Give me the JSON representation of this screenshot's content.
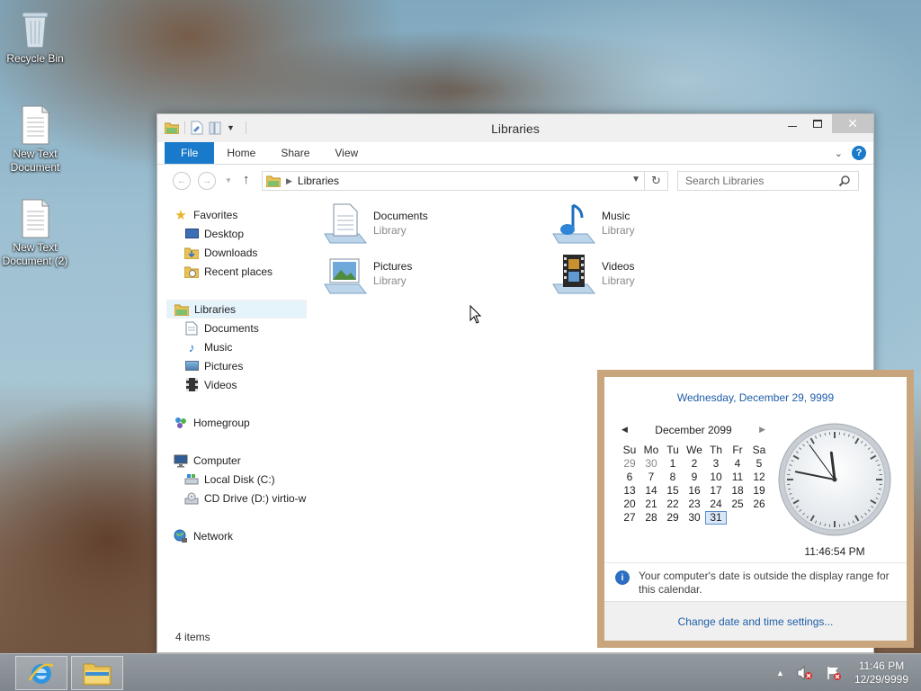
{
  "desktop": {
    "icons": [
      {
        "label": "Recycle Bin"
      },
      {
        "label": "New Text Document"
      },
      {
        "label": "New Text Document (2)"
      }
    ]
  },
  "window": {
    "title": "Libraries",
    "ribbon_tabs": [
      "File",
      "Home",
      "Share",
      "View"
    ],
    "address": {
      "crumb": "Libraries"
    },
    "search_placeholder": "Search Libraries",
    "status": "4 items"
  },
  "navpane": {
    "favorites": {
      "label": "Favorites",
      "items": [
        "Desktop",
        "Downloads",
        "Recent places"
      ]
    },
    "libraries": {
      "label": "Libraries",
      "items": [
        "Documents",
        "Music",
        "Pictures",
        "Videos"
      ]
    },
    "homegroup": "Homegroup",
    "computer": {
      "label": "Computer",
      "items": [
        "Local Disk (C:)",
        "CD Drive (D:) virtio-w"
      ]
    },
    "network": "Network"
  },
  "content": {
    "items": [
      {
        "name": "Documents",
        "type": "Library",
        "icon": "documents-library-icon"
      },
      {
        "name": "Music",
        "type": "Library",
        "icon": "music-library-icon"
      },
      {
        "name": "Pictures",
        "type": "Library",
        "icon": "pictures-library-icon"
      },
      {
        "name": "Videos",
        "type": "Library",
        "icon": "videos-library-icon"
      }
    ]
  },
  "flyout": {
    "long_date": "Wednesday, December 29, 9999",
    "calendar": {
      "month_label": "December 2099",
      "weekdays": [
        "Su",
        "Mo",
        "Tu",
        "We",
        "Th",
        "Fr",
        "Sa"
      ],
      "days": [
        {
          "d": "29",
          "dim": true
        },
        {
          "d": "30",
          "dim": true
        },
        {
          "d": "1"
        },
        {
          "d": "2"
        },
        {
          "d": "3"
        },
        {
          "d": "4"
        },
        {
          "d": "5"
        },
        {
          "d": "6"
        },
        {
          "d": "7"
        },
        {
          "d": "8"
        },
        {
          "d": "9"
        },
        {
          "d": "10"
        },
        {
          "d": "11"
        },
        {
          "d": "12"
        },
        {
          "d": "13"
        },
        {
          "d": "14"
        },
        {
          "d": "15"
        },
        {
          "d": "16"
        },
        {
          "d": "17"
        },
        {
          "d": "18"
        },
        {
          "d": "19"
        },
        {
          "d": "20"
        },
        {
          "d": "21"
        },
        {
          "d": "22"
        },
        {
          "d": "23"
        },
        {
          "d": "24"
        },
        {
          "d": "25"
        },
        {
          "d": "26"
        },
        {
          "d": "27"
        },
        {
          "d": "28"
        },
        {
          "d": "29"
        },
        {
          "d": "30"
        },
        {
          "d": "31",
          "today": true
        }
      ]
    },
    "clock": {
      "hours": 11,
      "minutes": 46,
      "seconds": 54
    },
    "time": "11:46:54 PM",
    "info": "Your computer's date is outside the display range for this calendar.",
    "link": "Change date and time settings..."
  },
  "taskbar": {
    "pinned": [
      "internet-explorer-icon",
      "file-explorer-icon"
    ],
    "tray_time": "11:46 PM",
    "tray_date": "12/29/9999"
  },
  "colors": {
    "accent": "#1979ca",
    "link": "#1e5ea8",
    "flyout_border": "#c9a57d"
  }
}
